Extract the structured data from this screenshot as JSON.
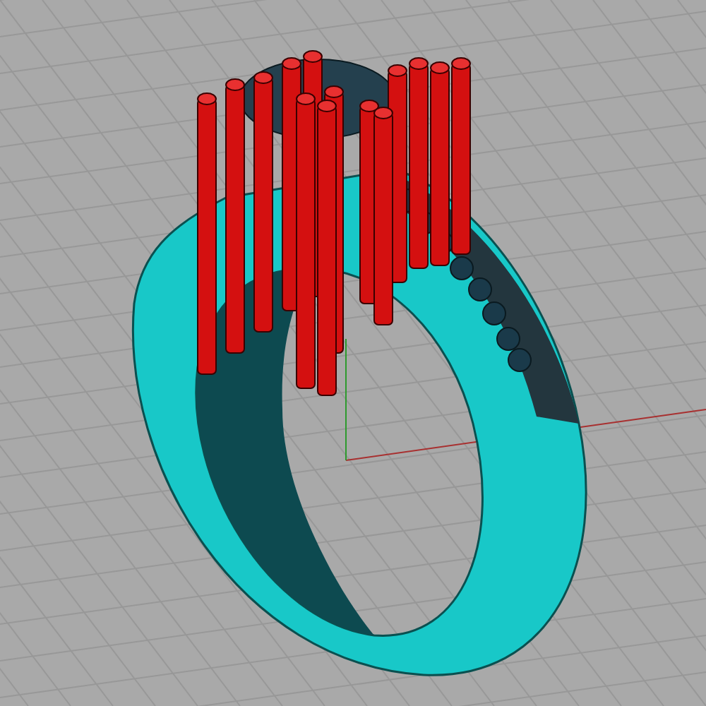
{
  "viewport": {
    "grid": true,
    "axes": true
  }
}
